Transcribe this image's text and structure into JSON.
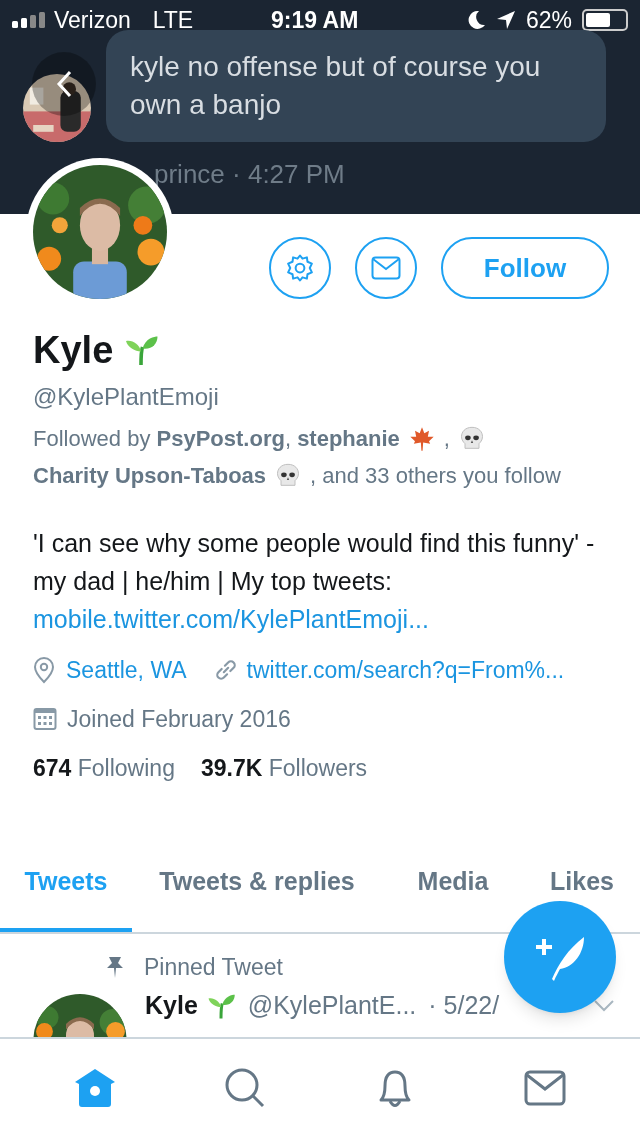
{
  "status_bar": {
    "carrier": "Verizon",
    "network": "LTE",
    "time": "9:19 AM",
    "battery": "62%"
  },
  "header": {
    "message": "kyle no offense but of course you own a banjo",
    "meta": "prince · 4:27 PM"
  },
  "profile": {
    "actions": [
      {
        "kind": "settings"
      },
      {
        "kind": "message"
      },
      {
        "kind": "follow",
        "label": "Follow"
      }
    ],
    "name": "Kyle",
    "handle": "@KylePlantEmoji",
    "followed_by": [
      {
        "kind": "text",
        "text": "Followed by **PsyPost.org**, **stephanie**"
      },
      {
        "kind": "maple"
      },
      {
        "kind": "text",
        "text": ","
      },
      {
        "kind": "skull"
      },
      {
        "kind": "text",
        "text": "**Charity Upson-Taboas**"
      },
      {
        "kind": "skull"
      },
      {
        "kind": "text",
        "text": ", and 33 others you follow"
      }
    ],
    "bio": "'I can see why some people would find this funny' - my dad | he/him | My top tweets:",
    "bio_link": "mobile.twitter.com/KylePlantEmoji...",
    "location": "Seattle, WA",
    "website": "twitter.com/search?q=From%...",
    "joined": "Joined February 2016",
    "stats": [
      {
        "count": "674",
        "label": "Following"
      },
      {
        "count": "39.7K",
        "label": "Followers"
      }
    ]
  },
  "tabs": [
    {
      "label": "Tweets",
      "selected": true
    },
    {
      "label": "Tweets & replies",
      "selected": false
    },
    {
      "label": "Media",
      "selected": false
    },
    {
      "label": "Likes",
      "selected": false
    }
  ],
  "pinned": {
    "label": "Pinned Tweet",
    "name": "Kyle",
    "handle": "@KylePlantE...",
    "date": "· 5/22/"
  },
  "nav": [
    {
      "kind": "home",
      "selected": true
    },
    {
      "kind": "search",
      "selected": false
    },
    {
      "kind": "notifications",
      "selected": false
    },
    {
      "kind": "messages",
      "selected": false
    }
  ]
}
